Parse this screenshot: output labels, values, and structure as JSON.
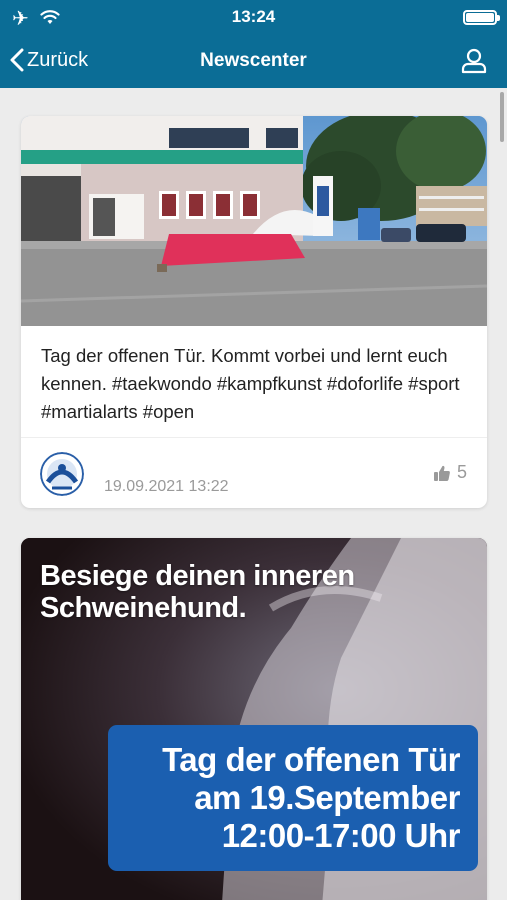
{
  "status_bar": {
    "time": "13:24",
    "icons": [
      "airplane-icon",
      "wifi-icon",
      "battery-icon"
    ]
  },
  "nav": {
    "back_label": "Zurück",
    "title": "Newscenter",
    "profile_icon": "user-icon"
  },
  "posts": [
    {
      "text": "Tag der offenen Tür. Kommt vorbei und lernt euch kennen. #taekwondo #kampfkunst #doforlife #sport #martialarts #open",
      "date": "19.09.2021 13:22",
      "likes": "5"
    },
    {
      "poster": {
        "headline_1": "Besiege deinen inneren",
        "headline_2": "Schweinehund.",
        "box_line_1": "Tag der offenen Tür",
        "box_line_2": "am 19.September",
        "box_line_3": "12:00-17:00 Uhr"
      }
    }
  ],
  "colors": {
    "header": "#0b6d96",
    "background": "#ececec",
    "poster_box": "#1b5fb0"
  }
}
